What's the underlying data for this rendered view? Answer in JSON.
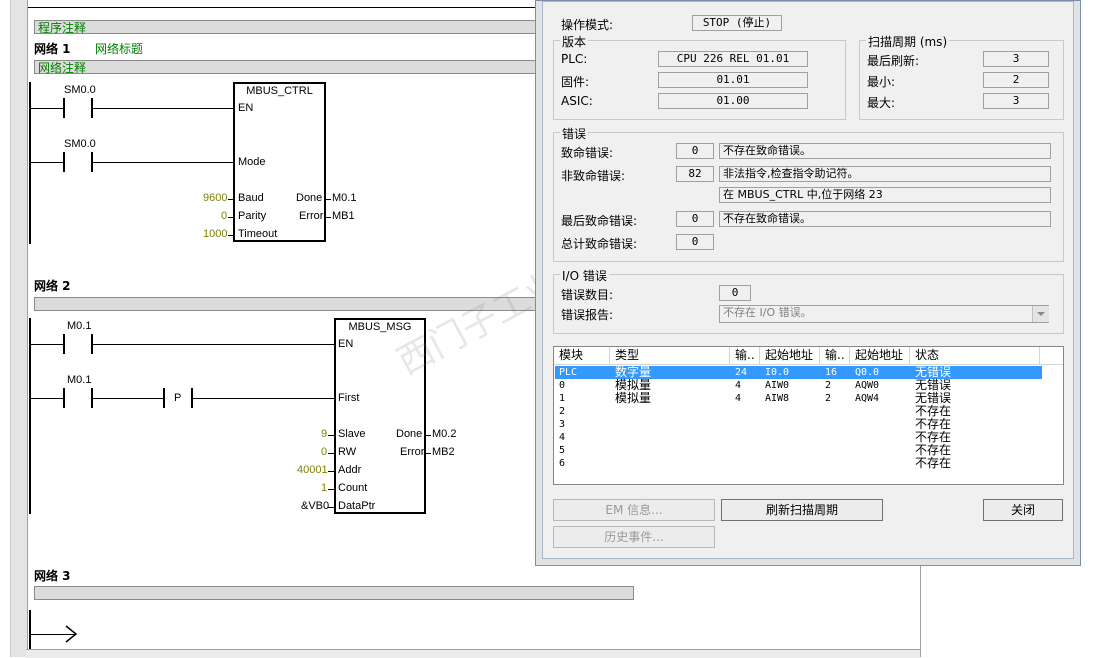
{
  "editor": {
    "program_comment": "程序注释",
    "network1": {
      "label": "网络 1",
      "title": "网络标题",
      "comment": "网络注释",
      "contact1": "SM0.0",
      "contact2": "SM0.0",
      "block": "MBUS_CTRL",
      "pins": {
        "en": "EN",
        "mode": "Mode",
        "baud": "Baud",
        "parity": "Parity",
        "timeout": "Timeout",
        "done": "Done",
        "error": "Error"
      },
      "values": {
        "baud": "9600",
        "parity": "0",
        "timeout": "1000",
        "done": "M0.1",
        "error": "MB1"
      }
    },
    "network2": {
      "label": "网络 2",
      "contact1": "M0.1",
      "contact2": "M0.1",
      "p_label": "P",
      "block": "MBUS_MSG",
      "pins": {
        "en": "EN",
        "first": "First",
        "slave": "Slave",
        "rw": "RW",
        "addr": "Addr",
        "count": "Count",
        "dataptr": "DataPtr",
        "done": "Done",
        "error": "Error"
      },
      "values": {
        "slave": "9",
        "rw": "0",
        "addr": "40001",
        "count": "1",
        "dataptr": "&VB0",
        "done": "M0.2",
        "error": "MB2"
      }
    },
    "network3": {
      "label": "网络 3"
    }
  },
  "dialog": {
    "op_mode_label": "操作模式:",
    "op_mode_value": "STOP (停止)",
    "version": {
      "title": "版本",
      "plc_label": "PLC:",
      "plc_value": "CPU 226 REL 01.01",
      "fw_label": "固件:",
      "fw_value": "01.01",
      "asic_label": "ASIC:",
      "asic_value": "01.00"
    },
    "scan": {
      "title": "扫描周期 (ms)",
      "last_label": "最后刷新:",
      "last_value": "3",
      "min_label": "最小:",
      "min_value": "2",
      "max_label": "最大:",
      "max_value": "3"
    },
    "errors": {
      "title": "错误",
      "fatal_label": "致命错误:",
      "fatal_code": "0",
      "fatal_text": "不存在致命错误。",
      "nonfatal_label": "非致命错误:",
      "nonfatal_code": "82",
      "nonfatal_text": "非法指令,检查指令助记符。",
      "nonfatal_detail": "在 MBUS_CTRL 中,位于网络 23",
      "last_fatal_label": "最后致命错误:",
      "last_fatal_code": "0",
      "last_fatal_text": "不存在致命错误。",
      "total_fatal_label": "总计致命错误:",
      "total_fatal_code": "0"
    },
    "io": {
      "title": "I/O 错误",
      "count_label": "错误数目:",
      "count_value": "0",
      "report_label": "错误报告:",
      "report_value": "不存在 I/O 错误。"
    },
    "table": {
      "headers": [
        "模块",
        "类型",
        "输..",
        "起始地址",
        "输..",
        "起始地址",
        "状态"
      ],
      "rows": [
        [
          "PLC",
          "数字量",
          "24",
          "I0.0",
          "16",
          "Q0.0",
          "无错误"
        ],
        [
          "0",
          "模拟量",
          "4",
          "AIW0",
          "2",
          "AQW0",
          "无错误"
        ],
        [
          "1",
          "模拟量",
          "4",
          "AIW8",
          "2",
          "AQW4",
          "无错误"
        ],
        [
          "2",
          "",
          "",
          "",
          "",
          "",
          "不存在"
        ],
        [
          "3",
          "",
          "",
          "",
          "",
          "",
          "不存在"
        ],
        [
          "4",
          "",
          "",
          "",
          "",
          "",
          "不存在"
        ],
        [
          "5",
          "",
          "",
          "",
          "",
          "",
          "不存在"
        ],
        [
          "6",
          "",
          "",
          "",
          "",
          "",
          "不存在"
        ]
      ]
    },
    "buttons": {
      "em_info": "EM 信息...",
      "refresh": "刷新扫描周期",
      "close": "关闭",
      "history": "历史事件..."
    }
  },
  "watermark": "西门子工业支持论坛"
}
